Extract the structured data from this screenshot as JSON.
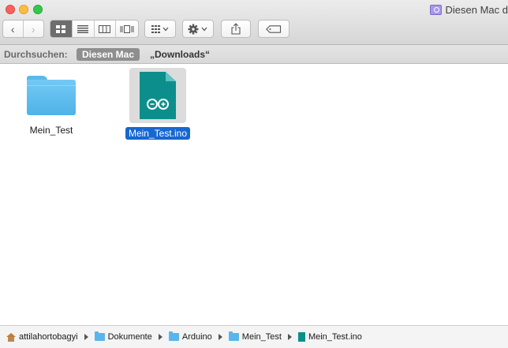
{
  "window": {
    "title": "Diesen Mac d"
  },
  "toolbar": {
    "back_label": "‹",
    "forward_label": "›",
    "view_modes": [
      "icons",
      "list",
      "columns",
      "cover-flow"
    ],
    "active_view": "icons"
  },
  "scope": {
    "label": "Durchsuchen:",
    "active_scope": "Diesen Mac",
    "folder_scope": "„Downloads“"
  },
  "files": [
    {
      "name": "Mein_Test",
      "kind": "folder",
      "selected": false
    },
    {
      "name": "Mein_Test.ino",
      "kind": "arduino-sketch",
      "selected": true
    }
  ],
  "path": [
    {
      "label": "attilahortobagyi",
      "icon": "home-icon"
    },
    {
      "label": "Dokumente",
      "icon": "folder-icon"
    },
    {
      "label": "Arduino",
      "icon": "folder-icon"
    },
    {
      "label": "Mein_Test",
      "icon": "folder-icon"
    },
    {
      "label": "Mein_Test.ino",
      "icon": "arduino-file-icon"
    }
  ],
  "colors": {
    "folder": "#5cb8ea",
    "arduino_teal": "#0c8f8c",
    "selection": "#1767d1"
  }
}
